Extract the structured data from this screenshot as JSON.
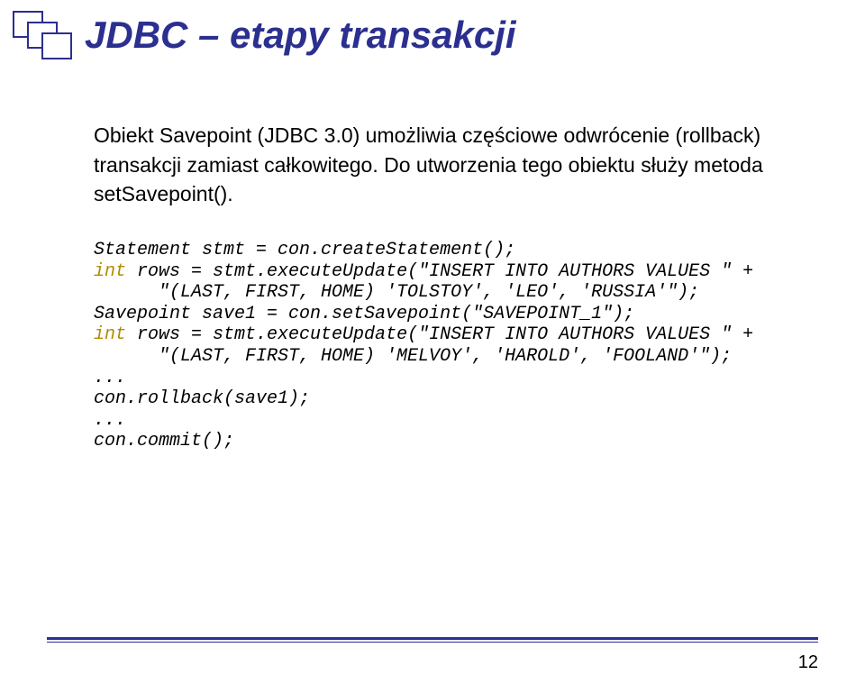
{
  "title": "JDBC – etapy transakcji",
  "body": "Obiekt Savepoint (JDBC 3.0) umożliwia częściowe odwrócenie (rollback) transakcji zamiast całkowitego. Do utworzenia tego obiektu służy metoda setSavepoint().",
  "code": {
    "l1a": "Statement stmt = con.createStatement();",
    "l2kw": "int",
    "l2b": " rows = stmt.executeUpdate(\"INSERT INTO AUTHORS VALUES \" +",
    "l3": "      \"(LAST, FIRST, HOME) 'TOLSTOY', 'LEO', 'RUSSIA'\");",
    "l4": "Savepoint save1 = con.setSavepoint(\"SAVEPOINT_1\");",
    "l5kw": "int",
    "l5b": " rows = stmt.executeUpdate(\"INSERT INTO AUTHORS VALUES \" +",
    "l6": "      \"(LAST, FIRST, HOME) 'MELVOY', 'HAROLD', 'FOOLAND'\");",
    "l7": "...",
    "l8": "con.rollback(save1);",
    "l9": "...",
    "l10": "con.commit();"
  },
  "page": "12"
}
